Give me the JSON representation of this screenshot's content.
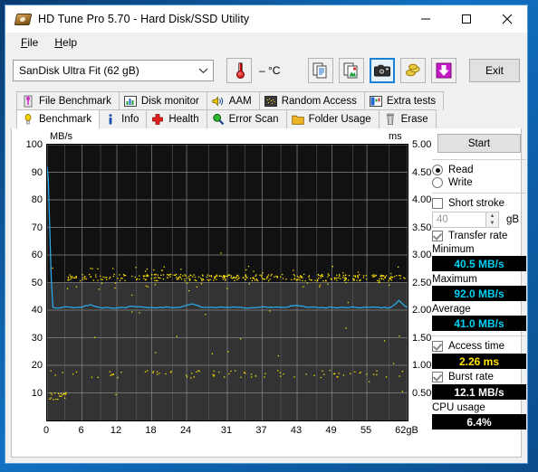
{
  "window": {
    "title": "HD Tune Pro 5.70 - Hard Disk/SSD Utility",
    "app_icon": "hard-disk-icon",
    "minimize": "–",
    "maximize": "□",
    "close": "✕"
  },
  "menu": {
    "items": [
      {
        "label": "File"
      },
      {
        "label": "Help"
      }
    ]
  },
  "toolbar": {
    "drive_selected": "SanDisk Ultra Fit (62 gB)",
    "dropdown_icon": "chevron-down-icon",
    "temperature": "– °C",
    "thermometer_icon": "thermometer-icon",
    "buttons": [
      {
        "name": "copy-text-button",
        "icon": "copy-text-icon",
        "selected": false
      },
      {
        "name": "copy-image-button",
        "icon": "copy-image-icon",
        "selected": false
      },
      {
        "name": "screenshot-button",
        "icon": "camera-icon",
        "selected": true
      },
      {
        "name": "coins-button",
        "icon": "coins-icon",
        "selected": false
      },
      {
        "name": "download-button",
        "icon": "down-arrow-icon",
        "selected": false
      }
    ],
    "exit_label": "Exit"
  },
  "tabs": {
    "row1": [
      {
        "label": "File Benchmark",
        "icon": "file-benchmark-icon",
        "active": false
      },
      {
        "label": "Disk monitor",
        "icon": "bar-chart-icon",
        "active": false
      },
      {
        "label": "AAM",
        "icon": "speaker-icon",
        "active": false
      },
      {
        "label": "Random Access",
        "icon": "scatter-icon",
        "active": false
      },
      {
        "label": "Extra tests",
        "icon": "extra-tests-icon",
        "active": false
      }
    ],
    "row2": [
      {
        "label": "Benchmark",
        "icon": "bulb-icon",
        "active": true
      },
      {
        "label": "Info",
        "icon": "info-icon",
        "active": false
      },
      {
        "label": "Health",
        "icon": "health-cross-icon",
        "active": false
      },
      {
        "label": "Error Scan",
        "icon": "magnifier-icon",
        "active": false
      },
      {
        "label": "Folder Usage",
        "icon": "folder-icon",
        "active": false
      },
      {
        "label": "Erase",
        "icon": "trash-icon",
        "active": false
      }
    ]
  },
  "panel": {
    "start_label": "Start",
    "mode": [
      {
        "label": "Read",
        "selected": true
      },
      {
        "label": "Write",
        "selected": false
      }
    ],
    "short_stroke": {
      "label": "Short stroke",
      "checked": false
    },
    "short_stroke_value": "40",
    "short_stroke_unit": "gB",
    "transfer_rate": {
      "label": "Transfer rate",
      "checked": true
    },
    "minimum_label": "Minimum",
    "minimum_value": "40.5 MB/s",
    "maximum_label": "Maximum",
    "maximum_value": "92.0 MB/s",
    "average_label": "Average",
    "average_value": "41.0 MB/s",
    "access_time": {
      "label": "Access time",
      "checked": true
    },
    "access_time_value": "2.26 ms",
    "burst_rate": {
      "label": "Burst rate",
      "checked": true
    },
    "burst_rate_value": "12.1 MB/s",
    "cpu_usage_label": "CPU usage",
    "cpu_usage_value": "6.4%"
  },
  "chart_data": {
    "type": "line",
    "title": "",
    "ylabel": "MB/s",
    "ylabel_right": "ms",
    "xlabel": "",
    "xlim": [
      0,
      62
    ],
    "ylim": [
      0,
      100
    ],
    "ylim_right": [
      0,
      5.0
    ],
    "yticks": [
      100,
      90,
      80,
      70,
      60,
      50,
      40,
      30,
      20,
      10
    ],
    "yticks_right": [
      "5.00",
      "4.50",
      "4.00",
      "3.50",
      "3.00",
      "2.50",
      "2.00",
      "1.50",
      "1.00",
      "0.50"
    ],
    "xticks": [
      "0",
      "6",
      "12",
      "18",
      "24",
      "31",
      "37",
      "43",
      "49",
      "55",
      "62gB"
    ],
    "grid": true,
    "plot_bg": "#111111",
    "series": [
      {
        "name": "Transfer rate",
        "type": "line",
        "color": "#2aa8e8",
        "axis": "left",
        "unit": "MB/s",
        "x": [
          0.0,
          0.2,
          0.4,
          0.7,
          1.0,
          1.5,
          3.0,
          4.5,
          6.0,
          7.5,
          9.0,
          11.0,
          13.0,
          15.0,
          17.0,
          19.0,
          21.0,
          23.0,
          25.0,
          27.0,
          29.0,
          31.0,
          33.0,
          35.0,
          37.0,
          39.0,
          41.0,
          43.0,
          45.0,
          47.0,
          49.0,
          51.0,
          53.0,
          55.0,
          57.0,
          59.0,
          60.5,
          61.5,
          62.0
        ],
        "y": [
          92.0,
          88.0,
          73.0,
          52.0,
          41.0,
          40.8,
          41.2,
          40.9,
          41.0,
          42.0,
          41.0,
          40.8,
          41.0,
          41.3,
          41.0,
          40.9,
          41.0,
          41.0,
          42.3,
          41.0,
          40.9,
          41.0,
          41.0,
          40.9,
          41.2,
          41.0,
          41.0,
          41.8,
          41.0,
          40.9,
          41.0,
          41.0,
          41.0,
          41.0,
          41.0,
          40.9,
          43.5,
          41.5,
          41.0
        ]
      },
      {
        "name": "Access time",
        "type": "scatter",
        "color": "#ffe400",
        "axis": "right",
        "unit": "ms",
        "main_band_ms": 2.6,
        "band_spread_ms": 0.12,
        "secondary_band_ms": 0.85,
        "cluster_band_ms": 0.45,
        "point_count": 520
      }
    ],
    "summary": {
      "minimum_mbps": 40.5,
      "maximum_mbps": 92.0,
      "average_mbps": 41.0,
      "access_time_ms": 2.26,
      "burst_rate_mbps": 12.1,
      "cpu_usage_pct": 6.4
    }
  }
}
